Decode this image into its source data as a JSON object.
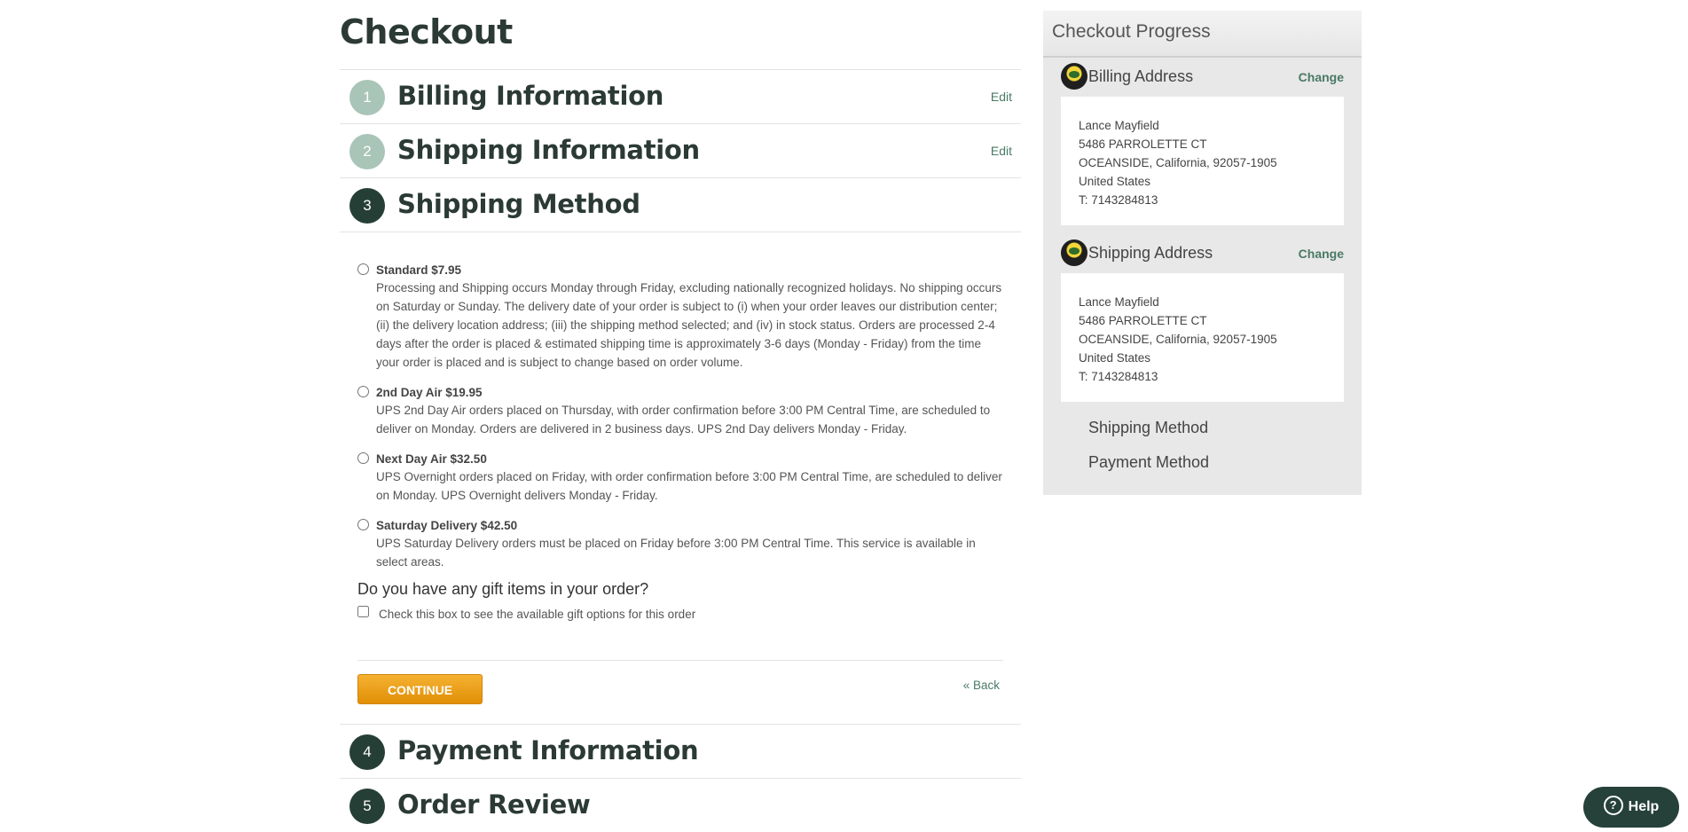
{
  "page": {
    "title": "Checkout"
  },
  "steps": [
    {
      "num": "1",
      "title": "Billing Information",
      "edit": "Edit"
    },
    {
      "num": "2",
      "title": "Shipping Information",
      "edit": "Edit"
    },
    {
      "num": "3",
      "title": "Shipping Method"
    },
    {
      "num": "4",
      "title": "Payment Information"
    },
    {
      "num": "5",
      "title": "Order Review"
    }
  ],
  "shipping_methods": [
    {
      "label": "Standard $7.95",
      "desc": "Processing and Shipping occurs Monday through Friday, excluding nationally recognized holidays. No shipping occurs on Saturday or Sunday. The delivery date of your order is subject to (i) when your order leaves our distribution center; (ii) the delivery location address; (iii) the shipping method selected; and (iv) in stock status. Orders are processed 2-4 days after the order is placed & estimated shipping time is approximately 3-6 days (Monday - Friday) from the time your order is placed and is subject to change based on order volume."
    },
    {
      "label": "2nd Day Air $19.95",
      "desc": "UPS 2nd Day Air orders placed on Thursday, with order confirmation before 3:00 PM Central Time, are scheduled to deliver on Monday. Orders are delivered in 2 business days. UPS 2nd Day delivers Monday - Friday."
    },
    {
      "label": "Next Day Air $32.50",
      "desc": "UPS Overnight orders placed on Friday, with order confirmation before 3:00 PM Central Time, are scheduled to deliver on Monday. UPS Overnight delivers Monday - Friday."
    },
    {
      "label": "Saturday Delivery $42.50",
      "desc": "UPS Saturday Delivery orders must be placed on Friday before 3:00 PM Central Time. This service is available in select areas."
    }
  ],
  "gift": {
    "question": "Do you have any gift items in your order?",
    "checkbox_label": "Check this box to see the available gift options for this order"
  },
  "actions": {
    "continue": "CONTINUE",
    "back": "« Back"
  },
  "progress": {
    "title": "Checkout Progress",
    "billing": {
      "heading": "Billing Address",
      "change": "Change",
      "lines": [
        "Lance Mayfield",
        "5486 PARROLETTE CT",
        "OCEANSIDE, California, 92057-1905",
        "United States",
        "T: 7143284813"
      ]
    },
    "shipping": {
      "heading": "Shipping Address",
      "change": "Change",
      "lines": [
        "Lance Mayfield",
        "5486 PARROLETTE CT",
        "OCEANSIDE, California, 92057-1905",
        "United States",
        "T: 7143284813"
      ]
    },
    "shipping_method": "Shipping Method",
    "payment_method": "Payment Method"
  },
  "help": {
    "label": "Help"
  }
}
